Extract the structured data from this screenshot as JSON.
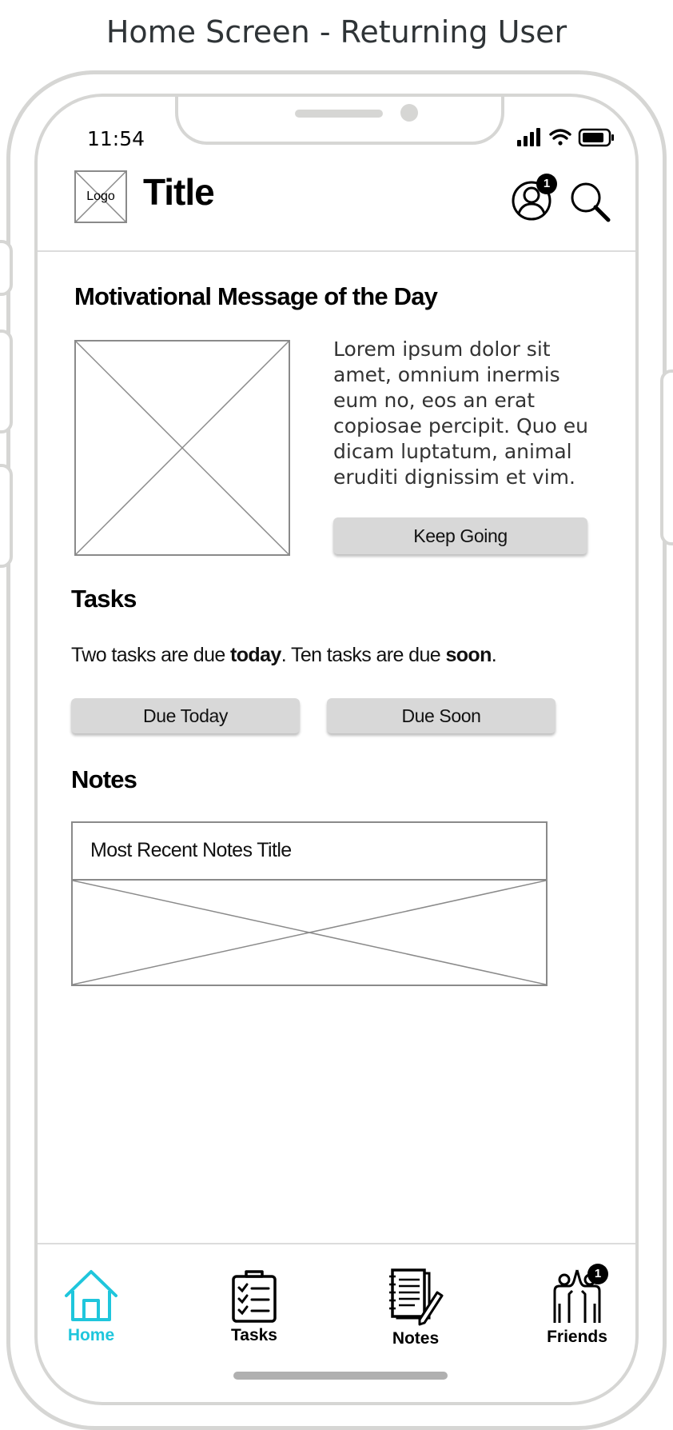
{
  "page_title": "Home Screen - Returning User",
  "status_bar": {
    "time": "11:54"
  },
  "header": {
    "logo_label": "Logo",
    "title": "Title",
    "profile_badge": "1"
  },
  "motd": {
    "heading": "Motivational Message of the Day",
    "text": "Lorem ipsum dolor sit amet, omnium inermis eum no, eos an erat copiosae percipit. Quo eu dicam luptatum, animal eruditi dignissim et vim.",
    "button_label": "Keep Going"
  },
  "tasks": {
    "heading": "Tasks",
    "summary_part1": "Two tasks are due ",
    "summary_bold1": "today",
    "summary_part2": ". Ten tasks are due ",
    "summary_bold2": "soon",
    "summary_part3": ".",
    "due_today_label": "Due Today",
    "due_soon_label": "Due Soon"
  },
  "notes": {
    "heading": "Notes",
    "recent_title": "Most Recent Notes Title"
  },
  "tab_bar": {
    "active_color": "#1fc6dc",
    "items": [
      {
        "label": "Home",
        "icon": "home-icon",
        "active": true
      },
      {
        "label": "Tasks",
        "icon": "clipboard-checklist-icon",
        "active": false
      },
      {
        "label": "Notes",
        "icon": "notebook-pen-icon",
        "active": false
      },
      {
        "label": "Friends",
        "icon": "friends-high-five-icon",
        "active": false,
        "badge": "1"
      }
    ]
  }
}
